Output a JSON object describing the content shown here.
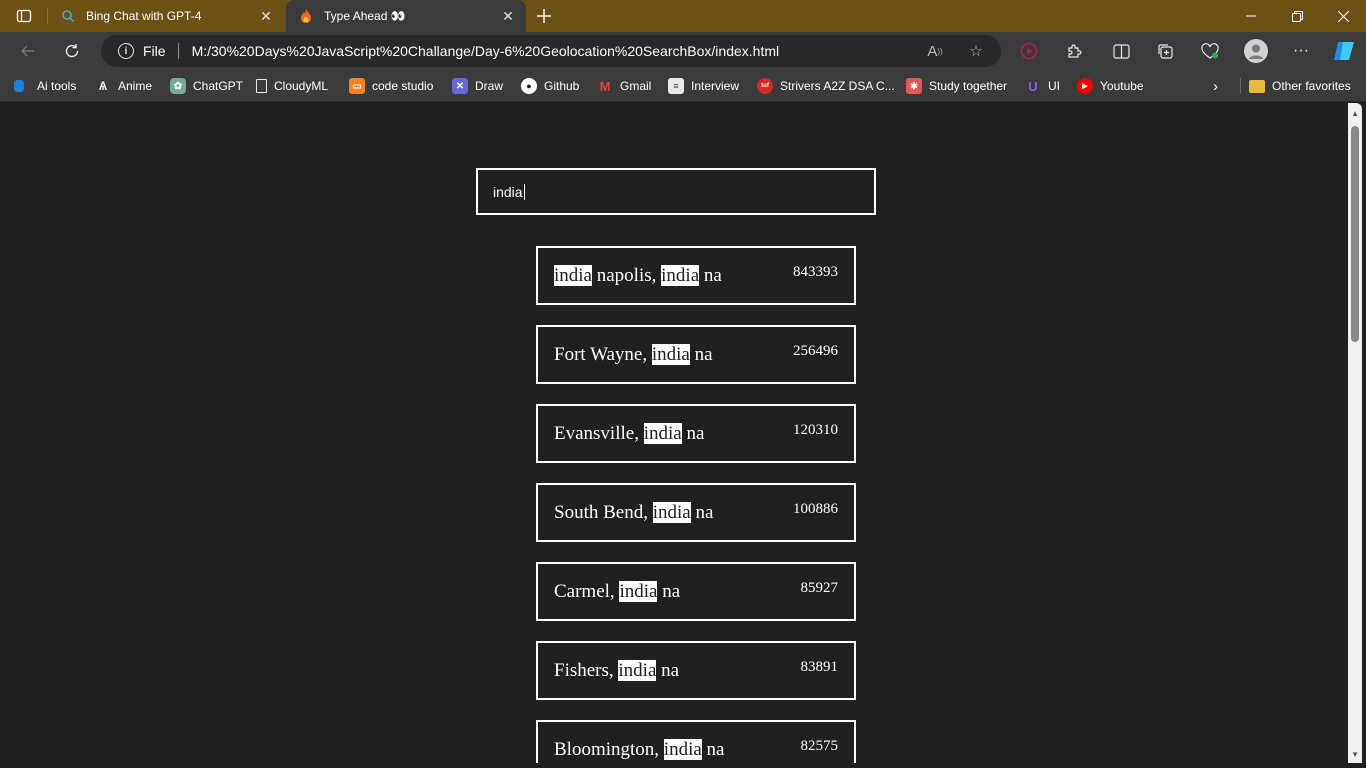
{
  "browser": {
    "tabs": [
      {
        "title": "Bing Chat with GPT-4",
        "favicon": "bing-icon",
        "active": false
      },
      {
        "title": "Type Ahead 👀",
        "favicon": "fire-icon",
        "active": true
      }
    ],
    "address": {
      "scheme": "File",
      "url": "M:/30%20Days%20JavaScript%20Challange/Day-6%20Geolocation%20SearchBox/index.html"
    },
    "bookmarks": [
      {
        "label": "Ai tools",
        "icon": "folder-icon"
      },
      {
        "label": "Anime",
        "icon": "anime-icon"
      },
      {
        "label": "ChatGPT",
        "icon": "chatgpt-icon"
      },
      {
        "label": "CloudyML",
        "icon": "page-icon"
      },
      {
        "label": "code studio",
        "icon": "codestudio-icon"
      },
      {
        "label": "Draw",
        "icon": "draw-icon"
      },
      {
        "label": "Github",
        "icon": "github-icon"
      },
      {
        "label": "Gmail",
        "icon": "gmail-icon"
      },
      {
        "label": "Interview",
        "icon": "interview-icon"
      },
      {
        "label": "Strivers A2Z DSA C...",
        "icon": "striver-icon"
      },
      {
        "label": "Study together",
        "icon": "study-icon"
      },
      {
        "label": "UI",
        "icon": "ui-icon"
      },
      {
        "label": "Youtube",
        "icon": "youtube-icon"
      },
      {
        "label": "Other favorites",
        "icon": "folder-icon"
      }
    ]
  },
  "page": {
    "search_value": "india",
    "highlight_color": "#ffffff",
    "results": [
      {
        "parts": [
          "",
          "india",
          " napolis, ",
          "india",
          " na"
        ],
        "population": "843393"
      },
      {
        "parts": [
          "Fort Wayne, ",
          "india",
          " na"
        ],
        "population": "256496"
      },
      {
        "parts": [
          "Evansville, ",
          "india",
          " na"
        ],
        "population": "120310"
      },
      {
        "parts": [
          "South Bend, ",
          "india",
          " na"
        ],
        "population": "100886"
      },
      {
        "parts": [
          "Carmel, ",
          "india",
          " na"
        ],
        "population": "85927"
      },
      {
        "parts": [
          "Fishers, ",
          "india",
          " na"
        ],
        "population": "83891"
      },
      {
        "parts": [
          "Bloomington, ",
          "india",
          " na"
        ],
        "population": "82575"
      }
    ]
  }
}
